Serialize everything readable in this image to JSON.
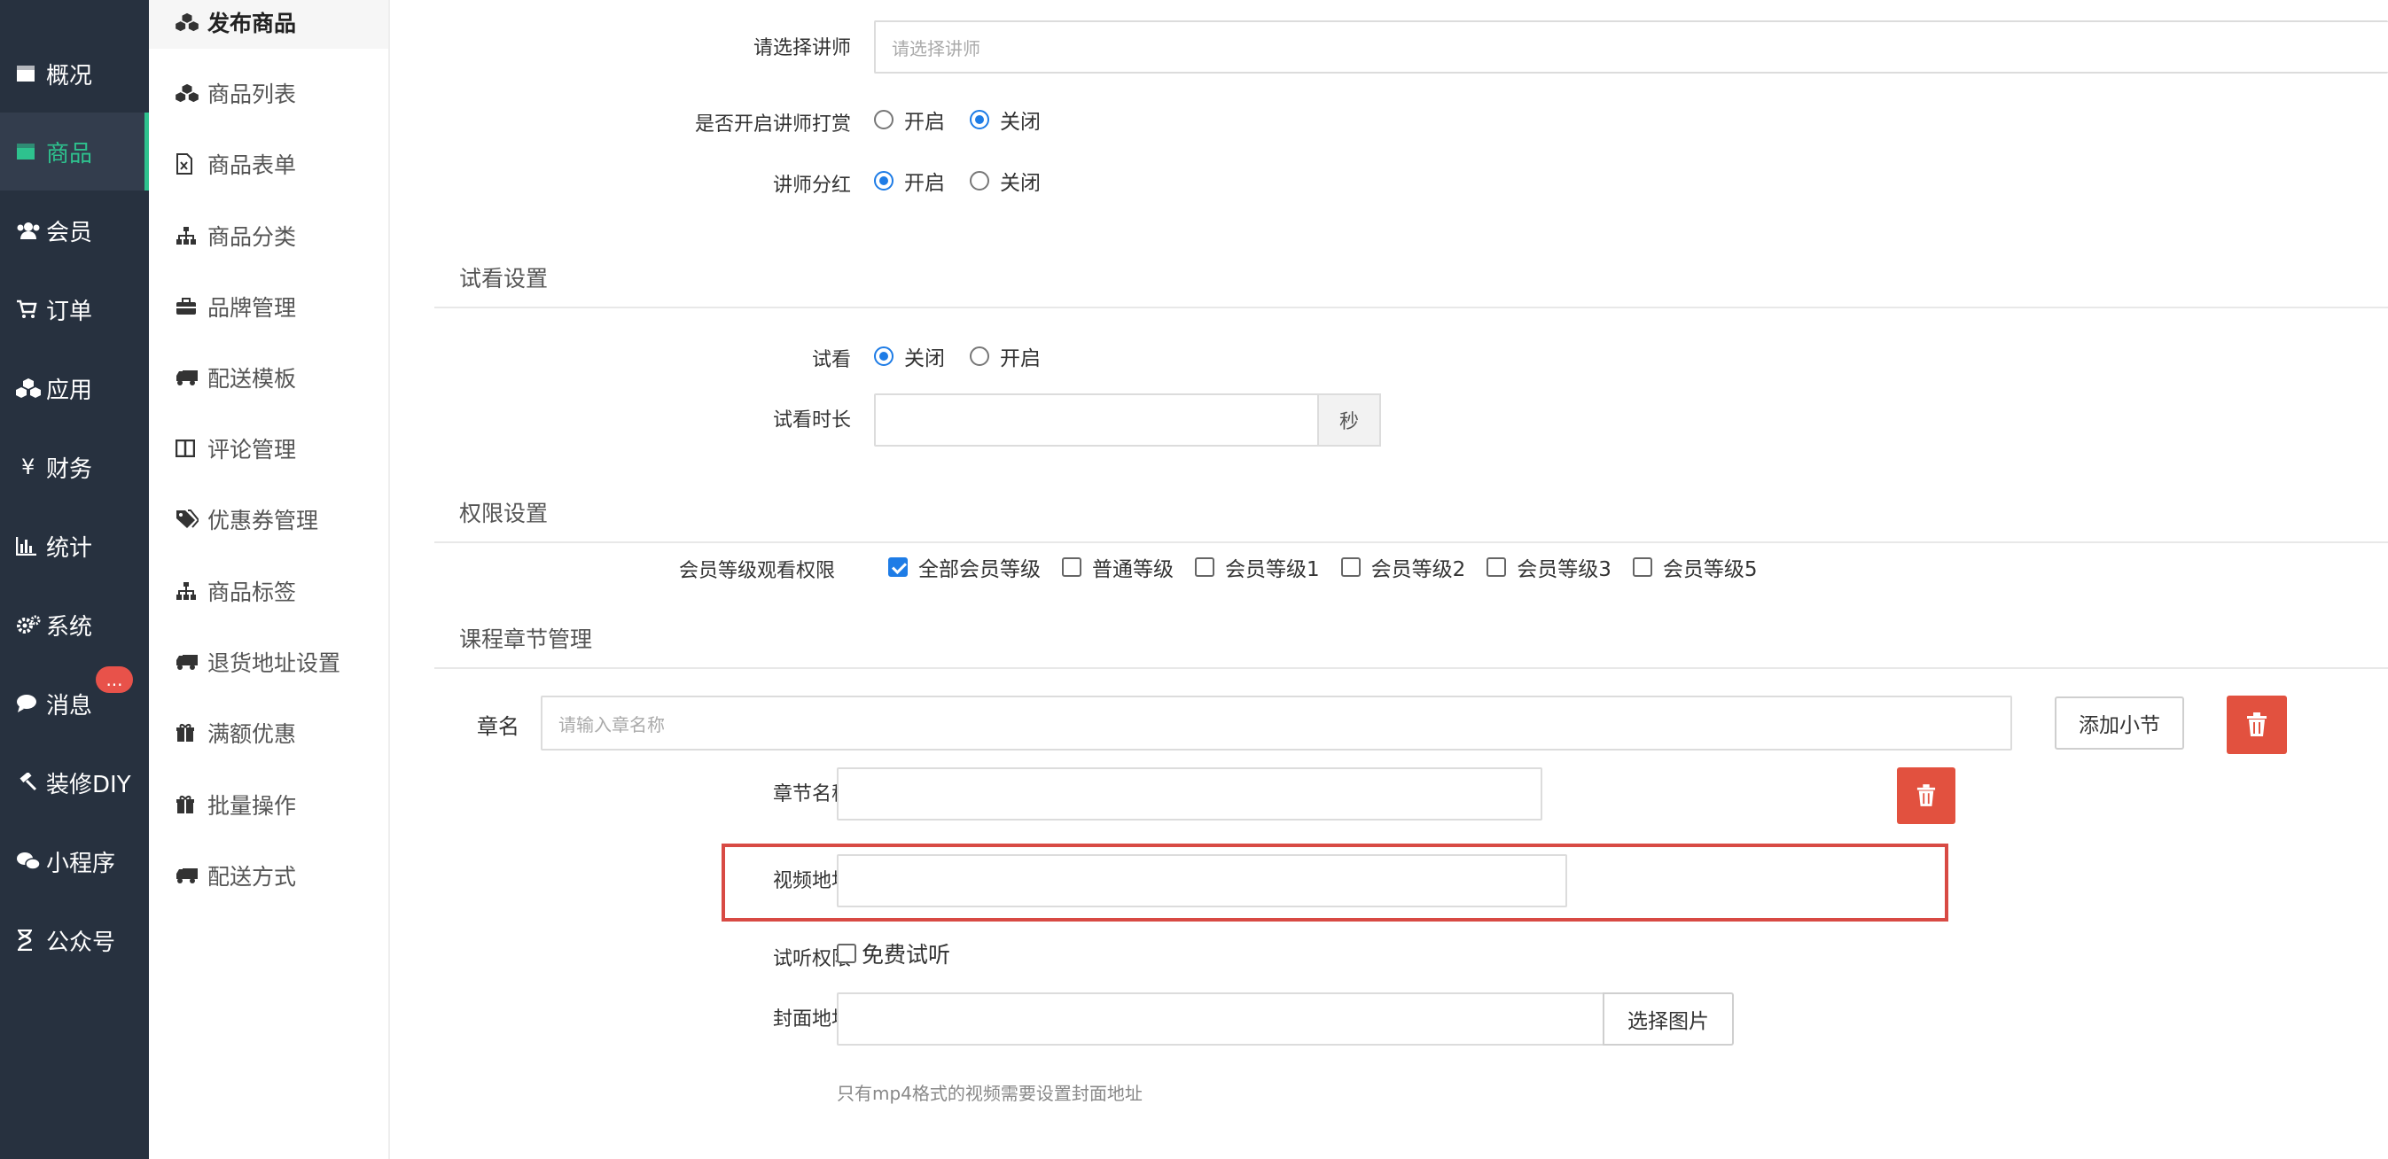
{
  "nav_primary": [
    {
      "label": "概况",
      "icon": "dashboard-icon"
    },
    {
      "label": "商品",
      "icon": "store-icon",
      "active": true
    },
    {
      "label": "会员",
      "icon": "users-icon"
    },
    {
      "label": "订单",
      "icon": "cart-icon"
    },
    {
      "label": "应用",
      "icon": "cubes-icon"
    },
    {
      "label": "财务",
      "icon": "yen-icon",
      "glyph": "¥"
    },
    {
      "label": "统计",
      "icon": "bar-chart-icon"
    },
    {
      "label": "系统",
      "icon": "cogs-icon"
    },
    {
      "label": "消息",
      "icon": "chat-icon"
    },
    {
      "label": "装修DIY",
      "icon": "gavel-icon"
    },
    {
      "label": "小程序",
      "icon": "wechat-icon"
    },
    {
      "label": "公众号",
      "icon": "hourglass-icon"
    }
  ],
  "message_badge": "...",
  "nav_secondary": [
    {
      "label": "发布商品",
      "icon": "cubes-icon",
      "active": true
    },
    {
      "label": "商品列表",
      "icon": "cubes-icon"
    },
    {
      "label": "商品表单",
      "icon": "excel-file-icon"
    },
    {
      "label": "商品分类",
      "icon": "sitemap-icon"
    },
    {
      "label": "品牌管理",
      "icon": "briefcase-icon"
    },
    {
      "label": "配送模板",
      "icon": "truck-icon"
    },
    {
      "label": "评论管理",
      "icon": "columns-icon"
    },
    {
      "label": "优惠券管理",
      "icon": "tags-icon"
    },
    {
      "label": "商品标签",
      "icon": "sitemap-icon"
    },
    {
      "label": "退货地址设置",
      "icon": "truck-icon"
    },
    {
      "label": "满额优惠",
      "icon": "gift-icon"
    },
    {
      "label": "批量操作",
      "icon": "gift-icon"
    },
    {
      "label": "配送方式",
      "icon": "truck-icon"
    }
  ],
  "form": {
    "lecturer_label": "请选择讲师",
    "lecturer_placeholder": "请选择讲师",
    "reward_label": "是否开启讲师打赏",
    "reward_on": "开启",
    "reward_off": "关闭",
    "reward_value": "关闭",
    "dividend_label": "讲师分红",
    "dividend_on": "开启",
    "dividend_off": "关闭",
    "dividend_value": "开启",
    "trial_section": "试看设置",
    "trial_label": "试看",
    "trial_off": "关闭",
    "trial_on": "开启",
    "trial_value": "关闭",
    "trial_duration_label": "试看时长",
    "trial_duration_unit": "秒",
    "permission_section": "权限设置",
    "member_level_label": "会员等级观看权限",
    "member_levels": [
      {
        "label": "全部会员等级",
        "checked": true
      },
      {
        "label": "普通等级",
        "checked": false
      },
      {
        "label": "会员等级1",
        "checked": false
      },
      {
        "label": "会员等级2",
        "checked": false
      },
      {
        "label": "会员等级3",
        "checked": false
      },
      {
        "label": "会员等级5",
        "checked": false
      }
    ],
    "chapter_section": "课程章节管理",
    "chapter_label": "章名",
    "chapter_placeholder": "请输入章名称",
    "add_section_button": "添加小节",
    "section_name_label": "章节名称",
    "video_url_label": "视频地址",
    "audition_label": "试听权限",
    "free_audition": "免费试听",
    "cover_label": "封面地址",
    "choose_image_button": "选择图片",
    "cover_hint": "只有mp4格式的视频需要设置封面地址"
  },
  "colors": {
    "sidebar_bg": "#27313f",
    "accent_green": "#2ec28e",
    "primary_blue": "#1e7ce6",
    "danger_red": "#e2513f",
    "highlight_red": "#d84a44"
  }
}
